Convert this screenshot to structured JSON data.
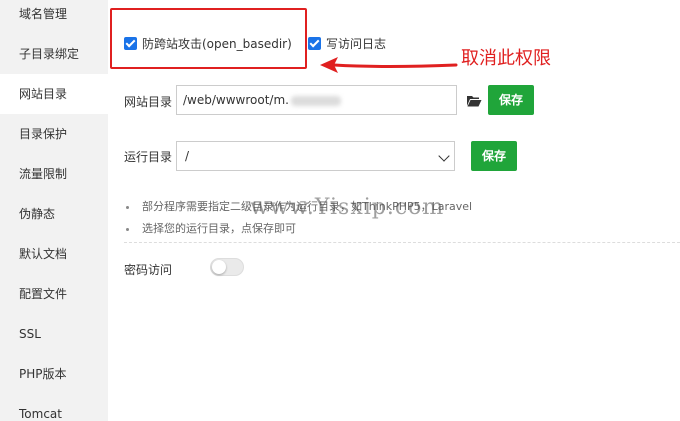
{
  "sidebar": {
    "items": [
      {
        "label": "域名管理"
      },
      {
        "label": "子目录绑定"
      },
      {
        "label": "网站目录",
        "active": true
      },
      {
        "label": "目录保护"
      },
      {
        "label": "流量限制"
      },
      {
        "label": "伪静态"
      },
      {
        "label": "默认文档"
      },
      {
        "label": "配置文件"
      },
      {
        "label": "SSL"
      },
      {
        "label": "PHP版本"
      },
      {
        "label": "Tomcat"
      }
    ]
  },
  "options": {
    "open_basedir_label": "防跨站攻击(open_basedir)",
    "open_basedir_checked": true,
    "access_log_label": "写访问日志",
    "access_log_checked": true
  },
  "annotation": {
    "text": "取消此权限",
    "color": "#e02020"
  },
  "site_dir": {
    "label": "网站目录",
    "value": "/web/wwwroot/m.",
    "browse_icon": "folder-open-icon",
    "save_label": "保存"
  },
  "run_dir": {
    "label": "运行目录",
    "selected": "/",
    "save_label": "保存"
  },
  "tips": [
    "部分程序需要指定二级目录作为运行目录，如ThinkPHP5，Laravel",
    "选择您的运行目录，点保存即可"
  ],
  "password_access": {
    "label": "密码访问",
    "enabled": false
  },
  "watermark": "www.Yisxip.com",
  "colors": {
    "accent_blue": "#1a73e8",
    "save_green": "#20a53a",
    "annotation_red": "#e02020",
    "sidebar_bg": "#f2f2f2"
  }
}
